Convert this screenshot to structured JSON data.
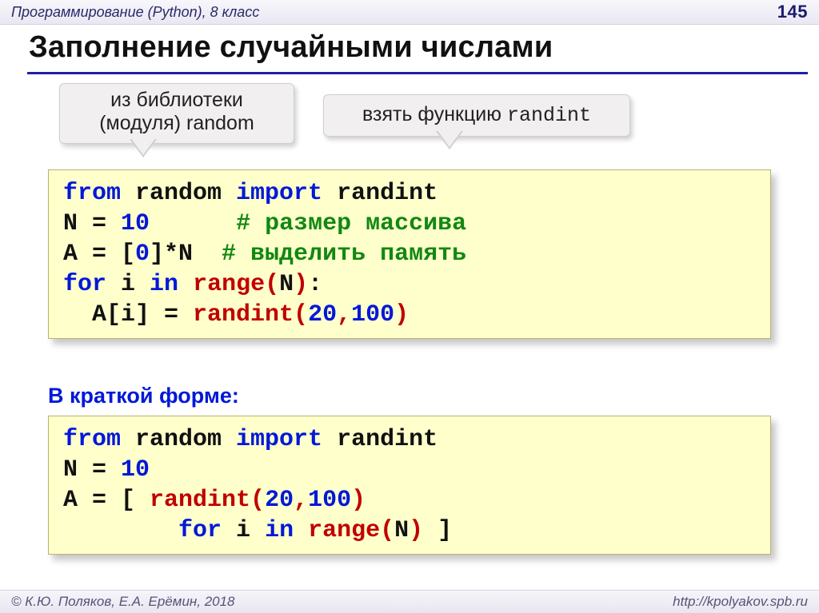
{
  "header": {
    "left": "Программирование (Python), 8 класс",
    "page": "145"
  },
  "title": "Заполнение случайными числами",
  "callouts": {
    "c1_line1": "из библиотеки",
    "c1_line2": "(модуля) random",
    "c2_prefix": "взять функцию ",
    "c2_mono": "randint"
  },
  "code1": {
    "l1_from": "from",
    "l1_mod": " random ",
    "l1_import": "import",
    "l1_name": " randint",
    "l2_a": "N = ",
    "l2_n": "10",
    "l2_sp": "      ",
    "l2_c": "# размер массива",
    "l3_a": "A = [",
    "l3_z": "0",
    "l3_b": "]*N  ",
    "l3_c": "# выделить память",
    "l4_for": "for",
    "l4_mid": " i ",
    "l4_in": "in",
    "l4_sp": " ",
    "l4_range": "range(",
    "l4_arg": "N",
    "l4_close": ")",
    "l4_colon": ":",
    "l5_a": "  A[i] = ",
    "l5_fn": "randint(",
    "l5_n1": "20",
    "l5_comma": ",",
    "l5_n2": "100",
    "l5_close": ")"
  },
  "subhead": "В краткой форме:",
  "code2": {
    "l1_from": "from",
    "l1_mod": " random ",
    "l1_import": "import",
    "l1_name": " randint",
    "l2_a": "N = ",
    "l2_n": "10",
    "l3_a": "A = [ ",
    "l3_fn": "randint(",
    "l3_n1": "20",
    "l3_comma": ",",
    "l3_n2": "100",
    "l3_close": ")",
    "l4_sp": "        ",
    "l4_for": "for",
    "l4_mid": " i ",
    "l4_in": "in",
    "l4_sp2": " ",
    "l4_range": "range(",
    "l4_arg": "N",
    "l4_close": ")",
    "l4_tail": " ]"
  },
  "footer": {
    "left": "© К.Ю. Поляков, Е.А. Ерёмин, 2018",
    "right": "http://kpolyakov.spb.ru"
  }
}
